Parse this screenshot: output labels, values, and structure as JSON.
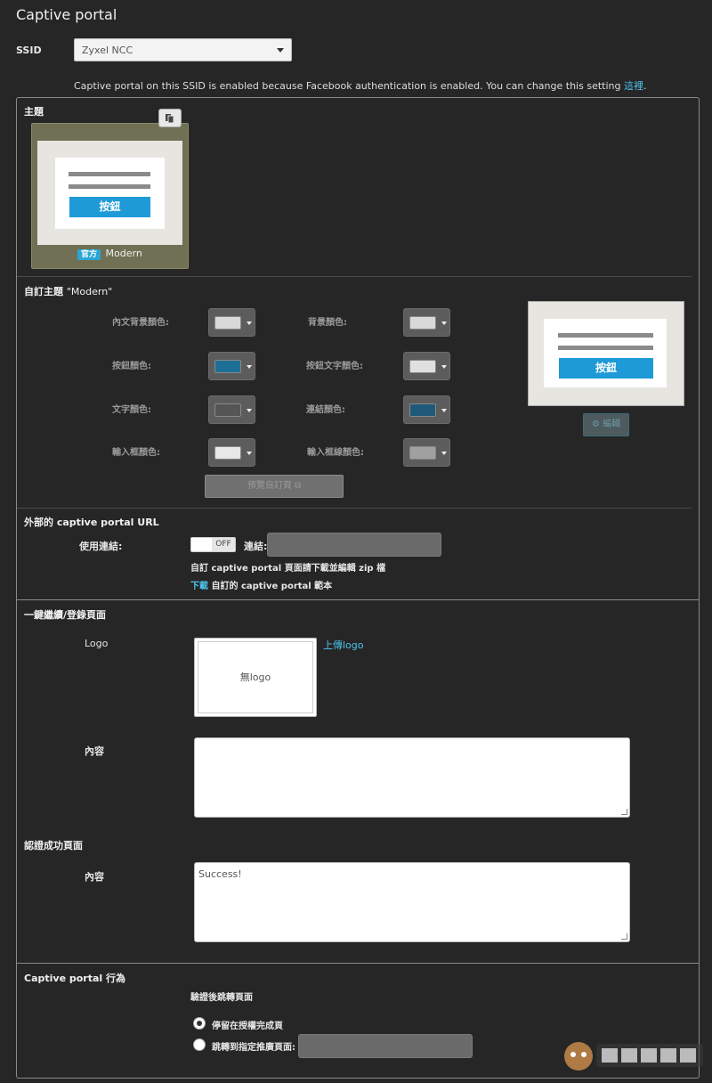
{
  "page": {
    "title": "Captive portal"
  },
  "ssid": {
    "label": "SSID",
    "selected": "Zyxel NCC"
  },
  "notice": {
    "text": "Captive portal on this SSID is enabled because Facebook authentication is enabled. You can change this setting ",
    "link": "這裡",
    "suffix": "."
  },
  "theme": {
    "heading": "主題",
    "card": {
      "badge": "官方",
      "name": "Modern",
      "button_label": "按鈕"
    }
  },
  "custom_theme": {
    "heading": "自訂主題",
    "theme_name": "\"Modern\"",
    "colors": [
      {
        "label": "內文背景顏色:",
        "value": "#d9d9d9"
      },
      {
        "label": "背景顏色:",
        "value": "#d9d9d9"
      },
      {
        "label": "按鈕顏色:",
        "value": "#1e6f96"
      },
      {
        "label": "按鈕文字顏色:",
        "value": "#e0e0e0"
      },
      {
        "label": "文字顏色:",
        "value": "#555555"
      },
      {
        "label": "連結顏色:",
        "value": "#1e5a78"
      },
      {
        "label": "輸入框顏色:",
        "value": "#e8e8e8"
      },
      {
        "label": "輸入框線顏色:",
        "value": "#a0a0a0"
      }
    ],
    "preview_button_label": "按鈕",
    "edit_button": "編輯",
    "preview_page_button": "預覽自訂頁"
  },
  "external_url": {
    "heading": "外部的 captive portal URL",
    "use_link_label": "使用連結:",
    "toggle_state": "OFF",
    "link_label": "連結:",
    "link_value": "",
    "hint": "自訂 captive portal 頁面請下載並編輯 zip 檔",
    "download_link": "下載",
    "download_suffix": " 自訂的 captive portal 範本"
  },
  "login_page": {
    "heading": "一鍵繼續/登錄頁面",
    "logo_label": "Logo",
    "logo_placeholder": "無logo",
    "upload_logo": "上傳logo",
    "content_label": "內容",
    "content_value": ""
  },
  "success_page": {
    "heading": "認證成功頁面",
    "content_label": "內容",
    "content_value": "Success!"
  },
  "behavior": {
    "heading": "Captive portal 行為",
    "redirect_label": "驗證後跳轉頁面",
    "options": [
      {
        "label": "停留在授權完成頁",
        "selected": true
      },
      {
        "label": "跳轉到指定推廣頁面:",
        "selected": false
      }
    ],
    "redirect_url": ""
  },
  "colors": {
    "accent": "#4ec3ee",
    "button_blue": "#1e9ad6",
    "background": "#262626"
  }
}
